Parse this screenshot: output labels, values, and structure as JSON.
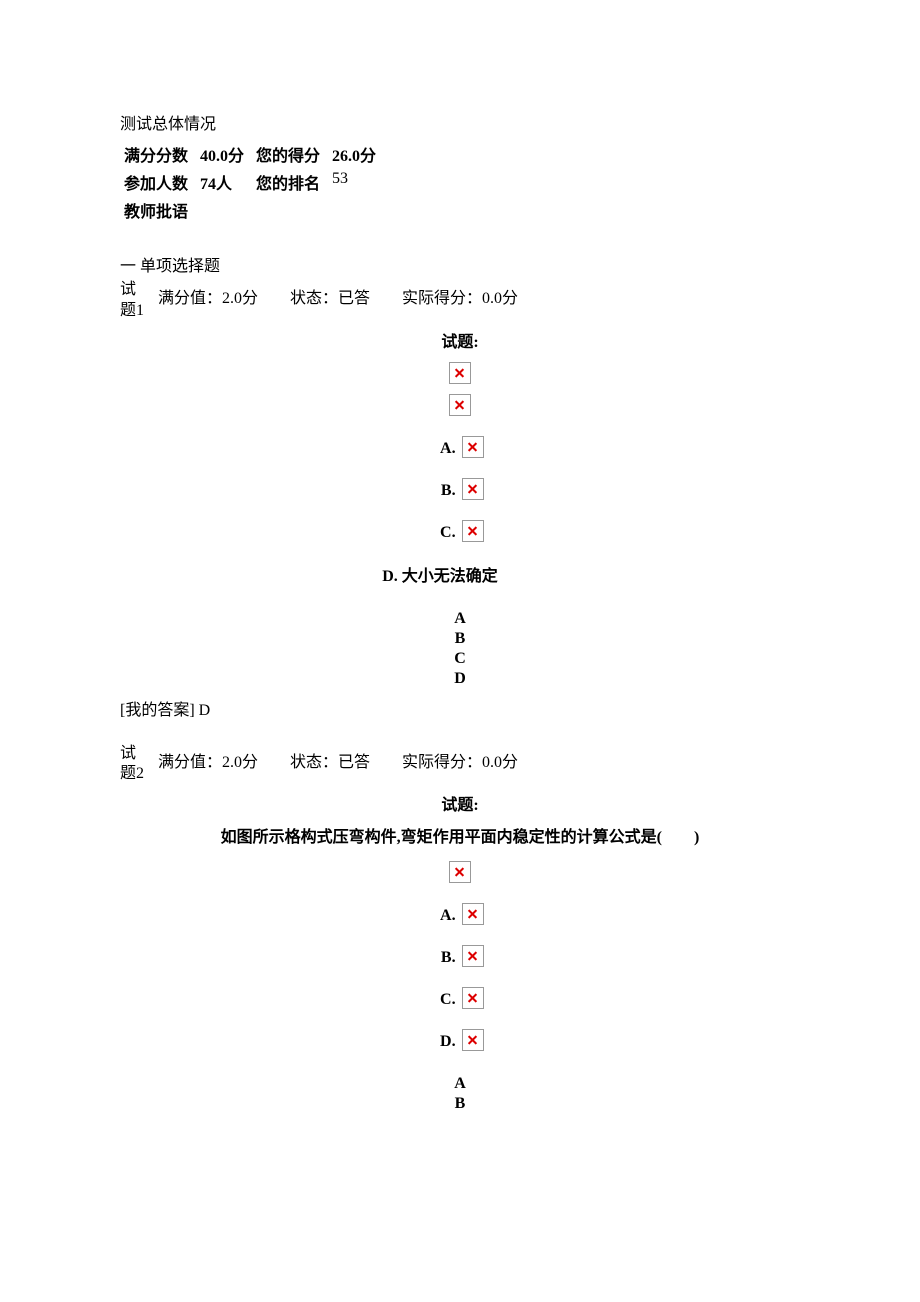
{
  "overview": {
    "title": "测试总体情况",
    "full_label": "满分分数",
    "full_value": "40.0分",
    "score_label": "您的得分",
    "score_value": "26.0分",
    "people_label": "参加人数",
    "people_value": "74人",
    "rank_label": "您的排名",
    "rank_value": "53",
    "comment_label": "教师批语"
  },
  "section1": {
    "heading": "一 单项选择题"
  },
  "q1": {
    "left_top": "试",
    "left_bottom": "题1",
    "meta": "满分值：2.0分　　状态：已答　　实际得分：0.0分",
    "title_word": "试题:",
    "optA": "A.",
    "optB": "B.",
    "optC": "C.",
    "optD_full": "D. 大小无法确定",
    "choices": [
      "A",
      "B",
      "C",
      "D"
    ],
    "my_ans_label": "[我的答案]",
    "my_ans_value": "D"
  },
  "q2": {
    "left_top": "试",
    "left_bottom": "题2",
    "meta": "满分值：2.0分　　状态：已答　　实际得分：0.0分",
    "title_word": "试题:",
    "stem": "如图所示格构式压弯构件,弯矩作用平面内稳定性的计算公式是(　　)",
    "optA": "A.",
    "optB": "B.",
    "optC": "C.",
    "optD": "D.",
    "choices": [
      "A",
      "B"
    ]
  }
}
